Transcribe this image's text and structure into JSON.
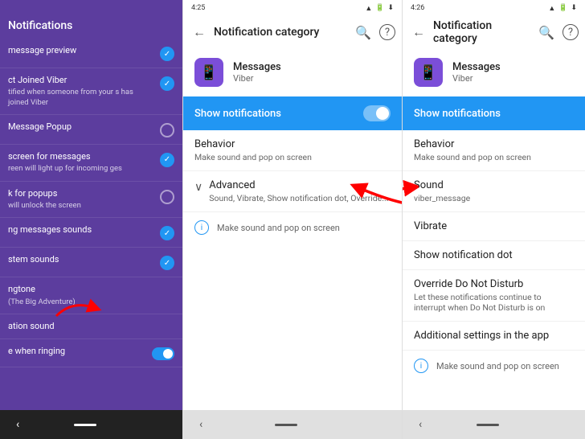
{
  "panel1": {
    "header": "Notifications",
    "items": [
      {
        "title": "message preview",
        "subtitle": "",
        "control": "check"
      },
      {
        "title": "ct Joined Viber",
        "subtitle": "tified when someone from your s has joined Viber",
        "control": "check"
      },
      {
        "title": "Message Popup",
        "subtitle": "",
        "control": "circle"
      },
      {
        "title": "screen for messages",
        "subtitle": "reen will light up for incoming ges",
        "control": "check"
      },
      {
        "title": "k for popups",
        "subtitle": "will unlock the screen",
        "control": "circle"
      },
      {
        "title": "ng messages sounds",
        "subtitle": "",
        "control": "check"
      },
      {
        "title": "stem sounds",
        "subtitle": "",
        "control": "check"
      },
      {
        "title": "ngtone",
        "subtitle": "(The Big Adventure)",
        "control": "arrow"
      },
      {
        "title": "ation sound",
        "subtitle": "",
        "control": ""
      },
      {
        "title": "e when ringing",
        "subtitle": "",
        "control": "toggle"
      }
    ],
    "nav": {
      "back": "‹",
      "home": ""
    }
  },
  "panel2": {
    "status_time": "4:25",
    "title": "Notification category",
    "app_name": "Messages",
    "app_sub": "Viber",
    "show_notifications": "Show notifications",
    "behavior_title": "Behavior",
    "behavior_sub": "Make sound and pop on screen",
    "advanced_title": "Advanced",
    "advanced_sub": "Sound, Vibrate, Show notification dot, Override...",
    "info_text": "Make sound and pop on screen",
    "icons": {
      "search": "🔍",
      "help": "?"
    }
  },
  "panel3": {
    "status_time": "4:26",
    "title": "Notification category",
    "app_name": "Messages",
    "app_sub": "Viber",
    "show_notifications": "Show notifications",
    "behavior_title": "Behavior",
    "behavior_sub": "Make sound and pop on screen",
    "sound_title": "Sound",
    "sound_sub": "viber_message",
    "vibrate_title": "Vibrate",
    "show_dot_title": "Show notification dot",
    "dnd_title": "Override Do Not Disturb",
    "dnd_sub": "Let these notifications continue to interrupt when Do Not Disturb is on",
    "additional_title": "Additional settings in the app",
    "info_text": "Make sound and pop on screen",
    "icons": {
      "search": "🔍",
      "help": "?"
    }
  }
}
